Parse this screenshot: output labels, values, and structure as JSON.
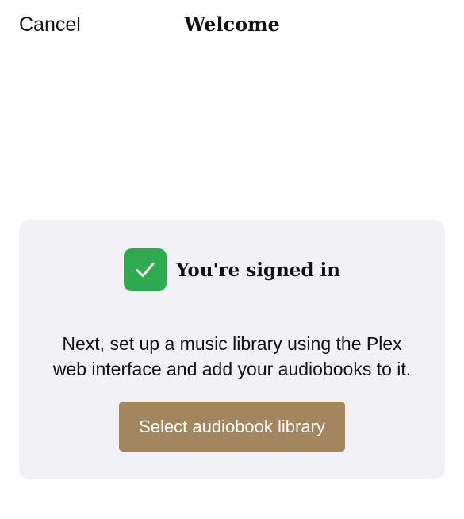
{
  "nav": {
    "cancel_label": "Cancel",
    "title": "Welcome"
  },
  "card": {
    "status_icon": "checkmark-icon",
    "status_text": "You're signed in",
    "message_lines": [
      "Next, set up a music library using the Plex",
      "web interface and add your audiobooks to it."
    ],
    "button_label": "Select audiobook library"
  },
  "colors": {
    "check_green": "#2eaa4f",
    "button_brown": "#a3865f",
    "card_background": "#f2f2f6"
  }
}
